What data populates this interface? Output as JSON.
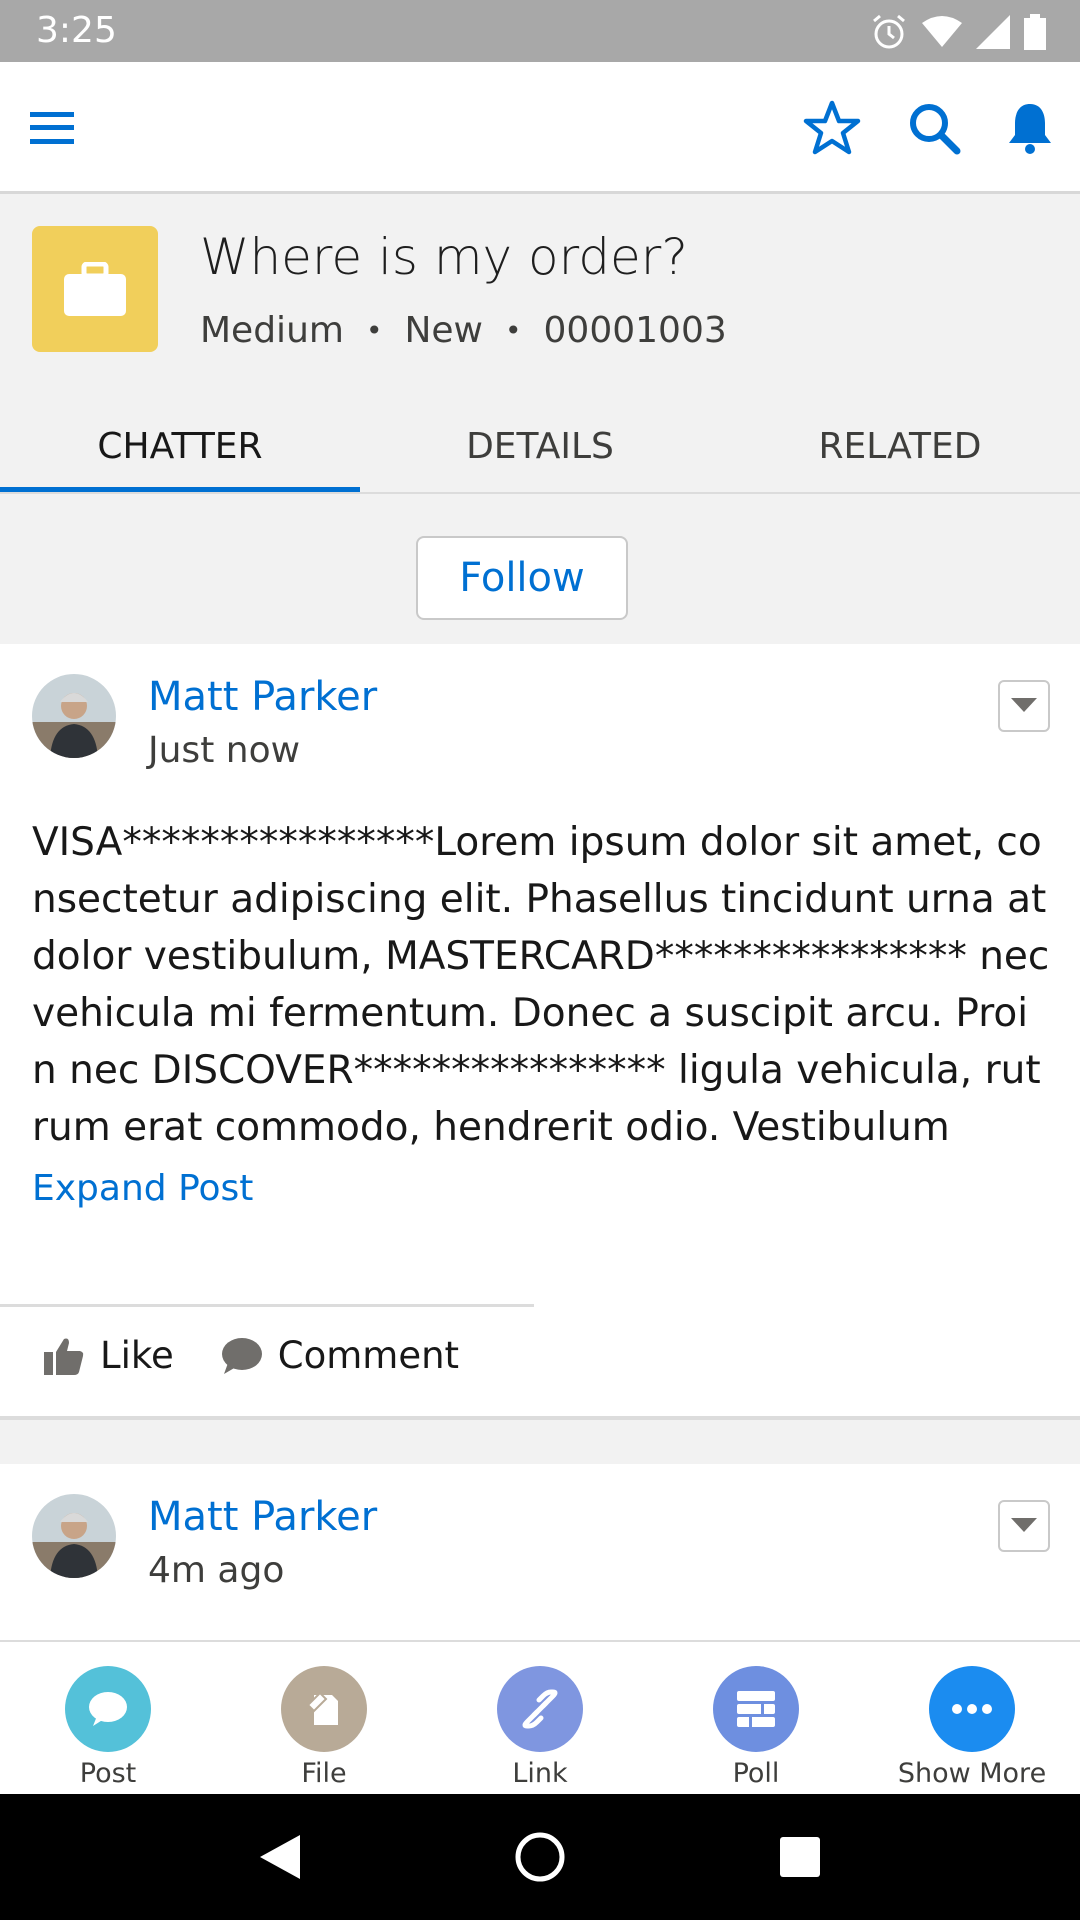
{
  "status_bar": {
    "time": "3:25"
  },
  "record": {
    "title": "Where is my order?",
    "priority": "Medium",
    "status": "New",
    "case_number": "00001003",
    "icon": "briefcase-icon",
    "icon_color": "#f1cf5b"
  },
  "tabs": [
    {
      "label": "CHATTER",
      "active": true
    },
    {
      "label": "DETAILS",
      "active": false
    },
    {
      "label": "RELATED",
      "active": false
    }
  ],
  "follow_label": "Follow",
  "posts": [
    {
      "author": "Matt Parker",
      "time": "Just now",
      "body": "VISA****************Lorem ipsum dolor sit amet, consectetur adipiscing elit. Phasellus tincidunt urna at dolor vestibulum, MASTERCARD**************** nec vehicula mi fermentum. Donec a suscipit arcu. Proin nec DISCOVER**************** ligula vehicula, rutrum erat commodo, hendrerit odio. Vestibulum",
      "expand_label": "Expand Post",
      "like_label": "Like",
      "comment_label": "Comment"
    },
    {
      "author": "Matt Parker",
      "time": "4m ago"
    }
  ],
  "action_bar": [
    {
      "label": "Post",
      "icon": "chat-bubble-icon",
      "color": "#54c1d9"
    },
    {
      "label": "File",
      "icon": "file-icon",
      "color": "#b8aa97"
    },
    {
      "label": "Link",
      "icon": "link-icon",
      "color": "#7f96e0"
    },
    {
      "label": "Poll",
      "icon": "poll-icon",
      "color": "#6e8fe0"
    },
    {
      "label": "Show More",
      "icon": "more-icon",
      "color": "#1b8cf0"
    }
  ],
  "colors": {
    "brand_blue": "#0070d2"
  }
}
